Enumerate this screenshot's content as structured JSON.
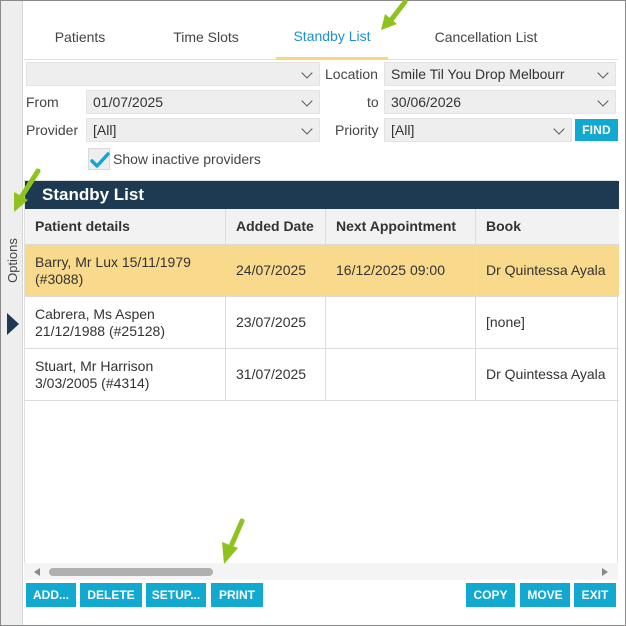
{
  "sidebar": {
    "options_label": "Options"
  },
  "tabs": [
    {
      "label": "Patients"
    },
    {
      "label": "Time Slots"
    },
    {
      "label": "Standby List",
      "active": true
    },
    {
      "label": "Cancellation List"
    }
  ],
  "filters": {
    "top_select": "",
    "location_label": "Location",
    "location_value": "Smile Til You Drop Melbourr",
    "from_label": "From",
    "from_value": "01/07/2025",
    "to_label": "to",
    "to_value": "30/06/2026",
    "provider_label": "Provider",
    "provider_value": "[All]",
    "priority_label": "Priority",
    "priority_value": "[All]",
    "find_label": "FIND",
    "inactive_label": "Show inactive providers",
    "inactive_checked": true
  },
  "standby": {
    "title": "Standby List",
    "columns": [
      "Patient details",
      "Added Date",
      "Next Appointment",
      "Book"
    ],
    "rows": [
      {
        "patient": "Barry, Mr Lux 15/11/1979 (#3088)",
        "added": "24/07/2025",
        "next": "16/12/2025 09:00",
        "book": "Dr Quintessa Ayala",
        "selected": true
      },
      {
        "patient": "Cabrera, Ms Aspen 21/12/1988 (#25128)",
        "added": "23/07/2025",
        "next": "",
        "book": "[none]",
        "selected": false
      },
      {
        "patient": "Stuart, Mr Harrison 3/03/2005 (#4314)",
        "added": "31/07/2025",
        "next": "",
        "book": "Dr Quintessa Ayala",
        "selected": false
      }
    ]
  },
  "actions": {
    "add": "ADD...",
    "delete": "DELETE",
    "setup": "SETUP...",
    "print": "PRINT",
    "copy": "COPY",
    "move": "MOVE",
    "exit": "EXIT"
  },
  "colors": {
    "accent": "#12a9d1",
    "header_bg": "#1d3a52",
    "selected_row": "#f9d98c",
    "active_tab_text": "#1f8fd6",
    "active_tab_underline": "#f7d877",
    "pointer": "#8dc21f"
  }
}
